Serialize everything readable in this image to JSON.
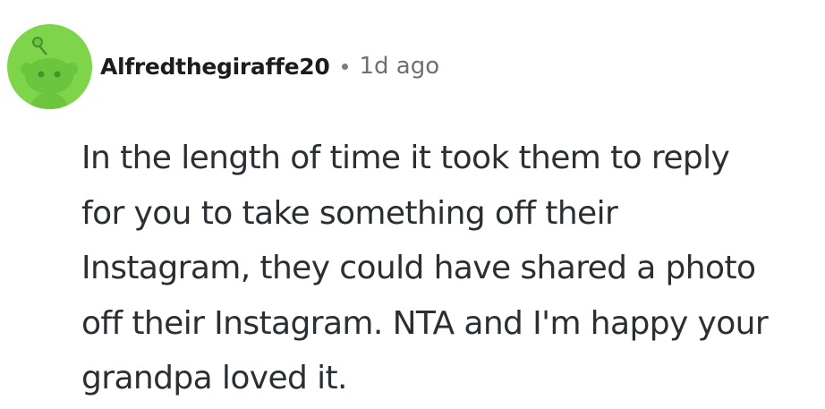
{
  "comment": {
    "author": "Alfredthegiraffe20",
    "separator": "•",
    "timestamp": "1d ago",
    "avatar_icon": "reddit-snoo-avatar-icon",
    "avatar_color": "#7ed54a",
    "body_lines": [
      "In the length of time it took them to reply",
      "for you to take something off their",
      "Instagram, they could have shared a photo",
      "off their Instagram. NTA and I'm happy your",
      "grandpa loved it."
    ]
  }
}
